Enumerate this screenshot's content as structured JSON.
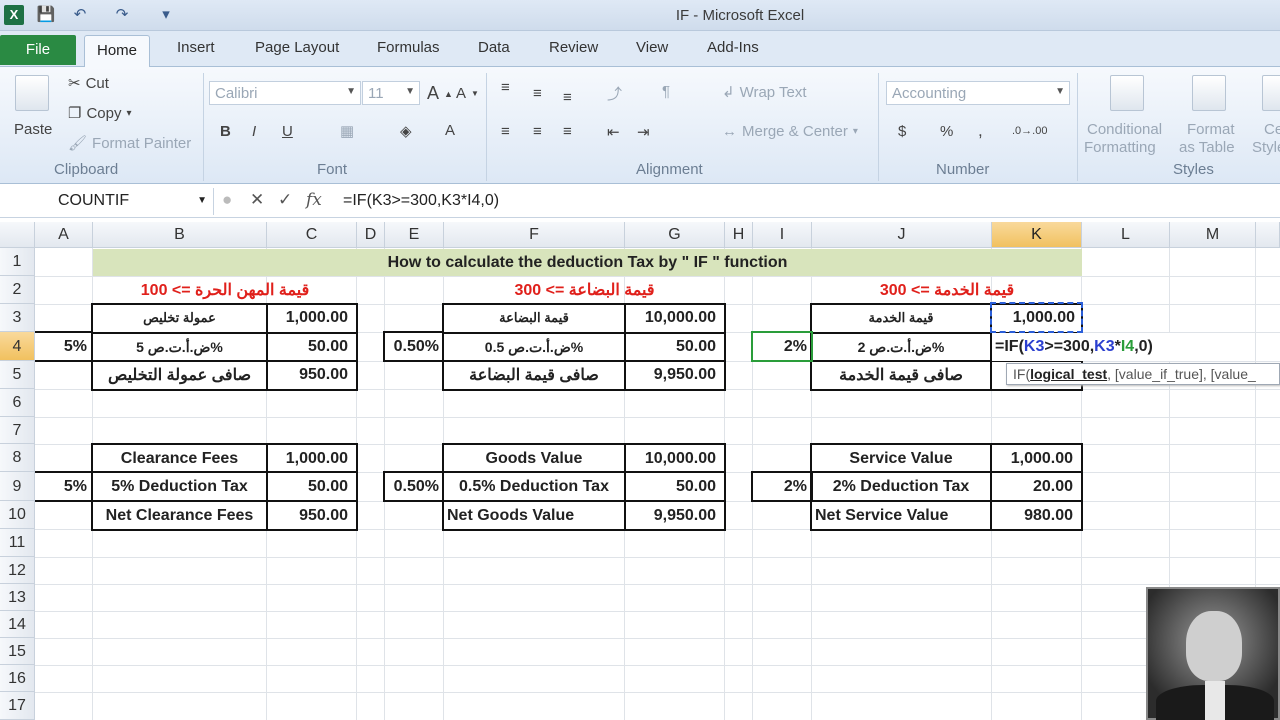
{
  "window": {
    "title": "IF  -  Microsoft Excel"
  },
  "ribbon": {
    "tabs": [
      "File",
      "Home",
      "Insert",
      "Page Layout",
      "Formulas",
      "Data",
      "Review",
      "View",
      "Add-Ins"
    ],
    "active_tab": "Home",
    "clipboard": {
      "label": "Clipboard",
      "paste": "Paste",
      "cut": "Cut",
      "copy": "Copy",
      "format_painter": "Format Painter"
    },
    "font": {
      "label": "Font",
      "name": "Calibri",
      "size": "11"
    },
    "alignment": {
      "label": "Alignment",
      "wrap_text": "Wrap Text",
      "merge_center": "Merge & Center"
    },
    "number": {
      "label": "Number",
      "format": "Accounting"
    },
    "styles": {
      "label": "Styles",
      "conditional_1": "Conditional",
      "conditional_2": "Formatting",
      "table_1": "Format",
      "table_2": "as Table",
      "cell_1": "Ce",
      "cell_2": "Style"
    }
  },
  "formula_bar": {
    "name_box": "COUNTIF",
    "formula": "=IF(K3>=300,K3*I4,0)"
  },
  "columns": [
    "A",
    "B",
    "C",
    "D",
    "E",
    "F",
    "G",
    "H",
    "I",
    "J",
    "K",
    "L",
    "M"
  ],
  "rows": [
    "1",
    "2",
    "3",
    "4",
    "5",
    "6",
    "7",
    "8",
    "9",
    "10",
    "11",
    "12",
    "13",
    "14",
    "15",
    "16",
    "17"
  ],
  "sheet": {
    "title": "How to calculate the deduction Tax by \" IF \" function",
    "free_prof_header": "100 <= قيمة المهن الحرة",
    "goods_header": "300 <= قيمة البضاعة",
    "service_header": "300 <= قيمة الخدمة",
    "clearance_ar": "عمولة تخليص",
    "clearance_tax_ar": "ض.أ.ت.ص 5%",
    "clearance_net_ar": "صافى عمولة التخليص",
    "goods_ar": "قيمة البضاعة",
    "goods_tax_ar": "ض.أ.ت.ص 0.5%",
    "goods_net_ar": "صافى قيمة البضاعة",
    "service_ar": "قيمة الخدمة",
    "service_tax_ar": "ض.أ.ت.ص 2%",
    "service_net_ar": "صافى قيمة الخدمة",
    "rate_a": "5%",
    "rate_e": "0.50%",
    "rate_i": "2%",
    "c3": "1,000.00",
    "c4": "50.00",
    "c5": "950.00",
    "g3": "10,000.00",
    "g4": "50.00",
    "g5": "9,950.00",
    "k3": "1,000.00",
    "k4_formula": "=IF(K3>=300,K3*I4,0)",
    "clearance_en": "Clearance Fees",
    "clearance_tax_en": "5% Deduction Tax",
    "clearance_net_en": "Net Clearance Fees",
    "goods_en": "Goods Value",
    "goods_tax_en": "0.5% Deduction Tax",
    "goods_net_en": "Net Goods Value",
    "service_en": "Service Value",
    "service_tax_en": "2% Deduction Tax",
    "service_net_en": "Net Service Value",
    "c8": "1,000.00",
    "c9": "50.00",
    "c10": "950.00",
    "g8": "10,000.00",
    "g9": "50.00",
    "g10": "9,950.00",
    "k8": "1,000.00",
    "k9": "20.00",
    "k10": "980.00",
    "tooltip": {
      "fn": "IF(",
      "arg1": "logical_test",
      "rest": ", [value_if_true], [value_"
    }
  }
}
